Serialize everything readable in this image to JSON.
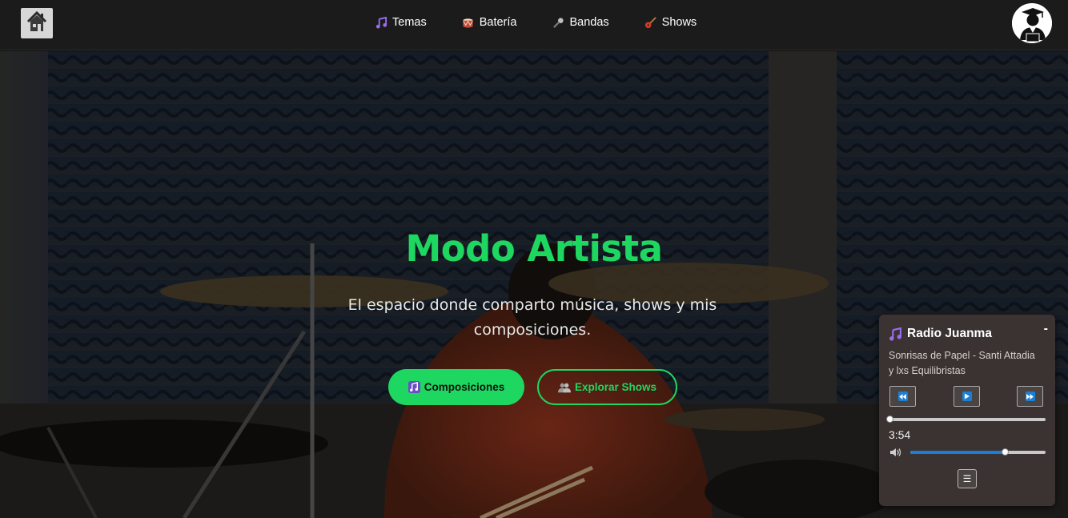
{
  "nav": {
    "home_icon": "house-icon",
    "links": [
      {
        "label": "Temas",
        "icon": "music-note-icon"
      },
      {
        "label": "Batería",
        "icon": "drum-icon"
      },
      {
        "label": "Bandas",
        "icon": "microphone-icon"
      },
      {
        "label": "Shows",
        "icon": "guitar-icon"
      }
    ],
    "avatar_icon": "graduate-avatar-icon"
  },
  "hero": {
    "title": "Modo Artista",
    "subtitle": "El espacio donde comparto música, shows y mis composiciones.",
    "primary_button": {
      "label": "Composiciones",
      "icon": "music-notes-icon"
    },
    "secondary_button": {
      "label": "Explorar Shows",
      "icon": "people-icon"
    }
  },
  "radio": {
    "title": "Radio Juanma",
    "title_icon": "music-note-icon",
    "minimize_label": "-",
    "song": "Sonrisas de Papel - Santi Attadia y lxs Equilibristas",
    "time": "3:54",
    "progress": 0.0,
    "volume": 0.7,
    "playlist_label": "☰"
  },
  "colors": {
    "accent": "#1ed760",
    "nav_bg": "#1b1b1b",
    "radio_bg": "#3a3332",
    "control_blue": "#1b7fd6"
  }
}
